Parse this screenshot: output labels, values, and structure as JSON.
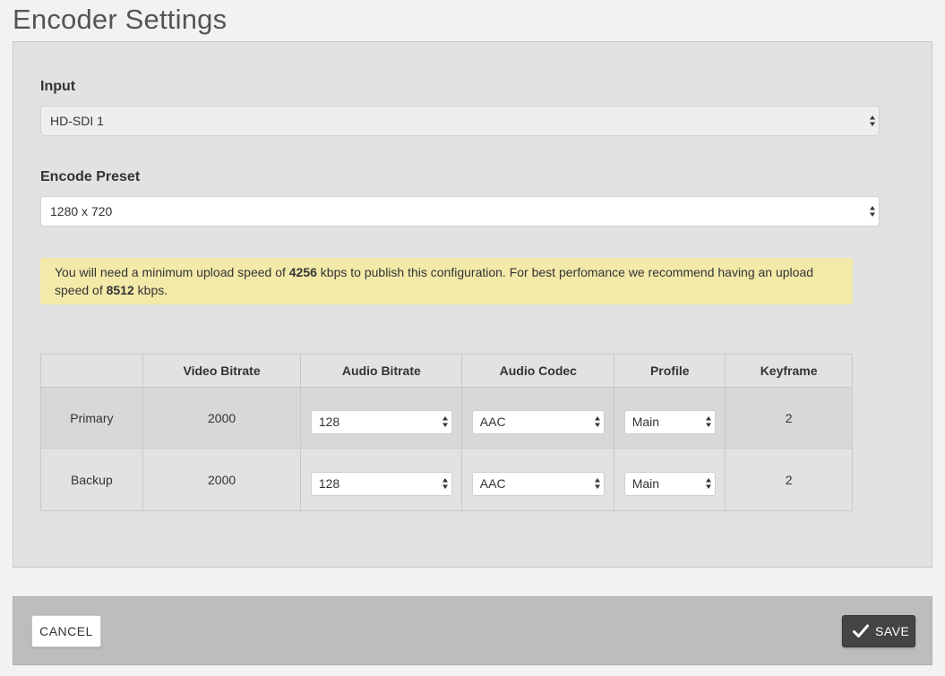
{
  "page": {
    "title": "Encoder Settings"
  },
  "input": {
    "label": "Input",
    "value": "HD-SDI 1"
  },
  "preset": {
    "label": "Encode Preset",
    "value": "1280 x 720"
  },
  "notice": {
    "part1": "You will need a minimum upload speed of ",
    "min_speed": "4256",
    "part2": " kbps to publish this configuration. For best perfomance we recommend having an upload speed of ",
    "rec_speed": "8512",
    "part3": " kbps.",
    "color": "#f3eaa9"
  },
  "table": {
    "headers": [
      "",
      "Video Bitrate",
      "Audio Bitrate",
      "Audio Codec",
      "Profile",
      "Keyframe"
    ],
    "rows": [
      {
        "name": "Primary",
        "video_bitrate": "2000",
        "audio_bitrate": "128",
        "audio_codec": "AAC",
        "profile": "Main",
        "keyframe": "2"
      },
      {
        "name": "Backup",
        "video_bitrate": "2000",
        "audio_bitrate": "128",
        "audio_codec": "AAC",
        "profile": "Main",
        "keyframe": "2"
      }
    ]
  },
  "footer": {
    "cancel_label": "CANCEL",
    "save_label": "SAVE",
    "save_icon": "checkmark-icon",
    "save_color": "#444444"
  }
}
